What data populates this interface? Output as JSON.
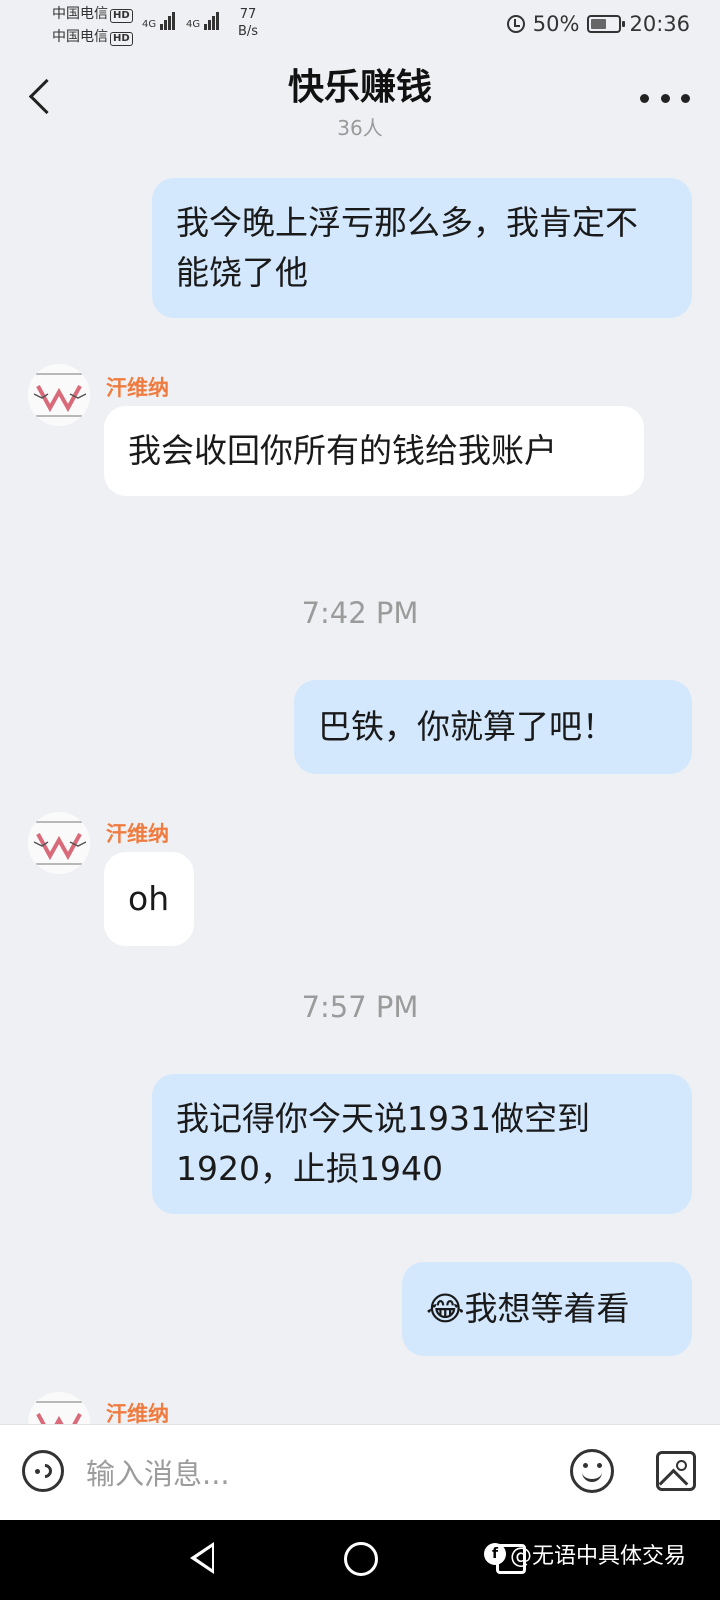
{
  "status_bar": {
    "carrier1": "中国电信",
    "carrier2": "中国电信",
    "hd": "HD",
    "network": "4G",
    "net_speed_value": "77",
    "net_speed_unit": "B/s",
    "battery": "50%",
    "time": "20:36"
  },
  "header": {
    "title": "快乐赚钱",
    "member_count": "36人"
  },
  "messages": [
    {
      "side": "me",
      "text": "我今晚上浮亏那么多，我肯定不能饶了他"
    },
    {
      "side": "other",
      "sender": "汗维纳",
      "text": "我会收回你所有的钱给我账户"
    },
    {
      "type": "time",
      "text": "7:42 PM"
    },
    {
      "side": "me",
      "text": "巴铁，你就算了吧！"
    },
    {
      "side": "other",
      "sender": "汗维纳",
      "text": "oh"
    },
    {
      "type": "time",
      "text": "7:57 PM"
    },
    {
      "side": "me",
      "text": "我记得你今天说1931做空到1920，止损1940"
    },
    {
      "side": "me",
      "text": "😂我想等着看"
    },
    {
      "side": "other",
      "sender": "汗维纳"
    }
  ],
  "input_bar": {
    "placeholder": "输入消息..."
  },
  "watermark": {
    "text": "@无语中具体交易"
  }
}
